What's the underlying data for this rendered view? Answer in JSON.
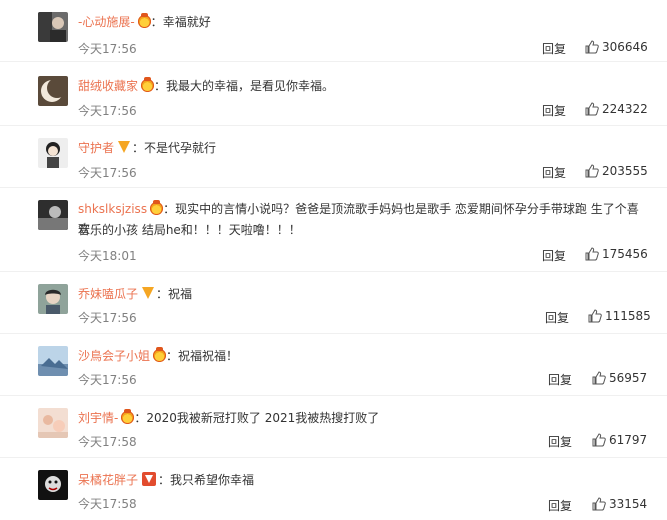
{
  "reply_label": "回复",
  "colon": "：",
  "comments": [
    {
      "username": "-心动施展-",
      "badge": "gold",
      "text": "幸福就好",
      "time": "今天17:56",
      "likes": "306646"
    },
    {
      "username": "甜绒收藏家",
      "badge": "gold",
      "text": "我最大的幸福，是看见你幸福。",
      "time": "今天17:56",
      "likes": "224322"
    },
    {
      "username": "守护者",
      "badge": "vip-yellow",
      "text": "不是代孕就行",
      "time": "今天17:56",
      "likes": "203555"
    },
    {
      "username": "shkslksjziss",
      "badge": "gold",
      "text_line1": "现实中的言情小说吗？爸爸是顶流歌手妈妈也是歌手 恋爱期间怀孕分手带球跑 生了个喜欢",
      "text_line2": "音乐的小孩 结局he和！！！天啦噜！！！",
      "time": "今天18:01",
      "likes": "175456"
    },
    {
      "username": "乔妹嗑瓜子",
      "badge": "vip-yellow",
      "text": "祝福",
      "time": "今天17:56",
      "likes": "111585"
    },
    {
      "username": "沙鳥会子小姐",
      "badge": "gold",
      "text": "祝福祝福！",
      "time": "今天17:56",
      "likes": "56957"
    },
    {
      "username": "刘宇情-",
      "badge": "gold",
      "text": "2020我被新冠打败了 2021我被热搜打败了",
      "time": "今天17:58",
      "likes": "61797"
    },
    {
      "username": "呆橘花胖子",
      "badge": "vip-red",
      "text": "我只希望你幸福",
      "time": "今天17:58",
      "likes": "33154"
    }
  ],
  "colors": {
    "username": "#eb7350",
    "time": "#808080",
    "text": "#333333",
    "badge": "#f5a623"
  }
}
